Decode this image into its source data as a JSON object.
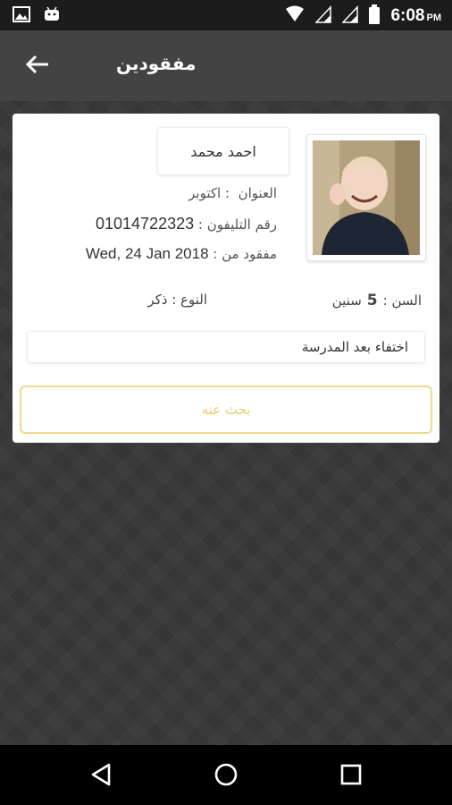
{
  "status_bar": {
    "time": "6:08",
    "ampm": "PM",
    "left_icons": [
      "image-icon",
      "android-icon"
    ],
    "right_icons": [
      "wifi-icon",
      "signal-icon",
      "signal-icon",
      "battery-icon"
    ]
  },
  "app_bar": {
    "title": "مفقودين",
    "back_icon": "arrow-left-icon"
  },
  "card": {
    "name": "احمد محمد",
    "address_label": "العنوان",
    "address_value": "اكتوبر",
    "phone_label": "رقم التليفون",
    "phone_value": "01014722323",
    "missing_since_label": "مفقود من",
    "missing_since_value": "Wed, 24 Jan 2018",
    "age_label": "السن",
    "age_value": "5",
    "age_unit": "سنين",
    "gender_label": "النوع",
    "gender_value": "ذكر",
    "description": "اختفاء بعد المدرسة",
    "search_button": "بحث عنه"
  },
  "colors": {
    "accent": "#eccd6a",
    "app_bar": "#434343",
    "background": "#3a3a3a"
  },
  "nav_bar": {
    "icons": [
      "back-triangle-icon",
      "home-circle-icon",
      "recents-square-icon"
    ]
  }
}
